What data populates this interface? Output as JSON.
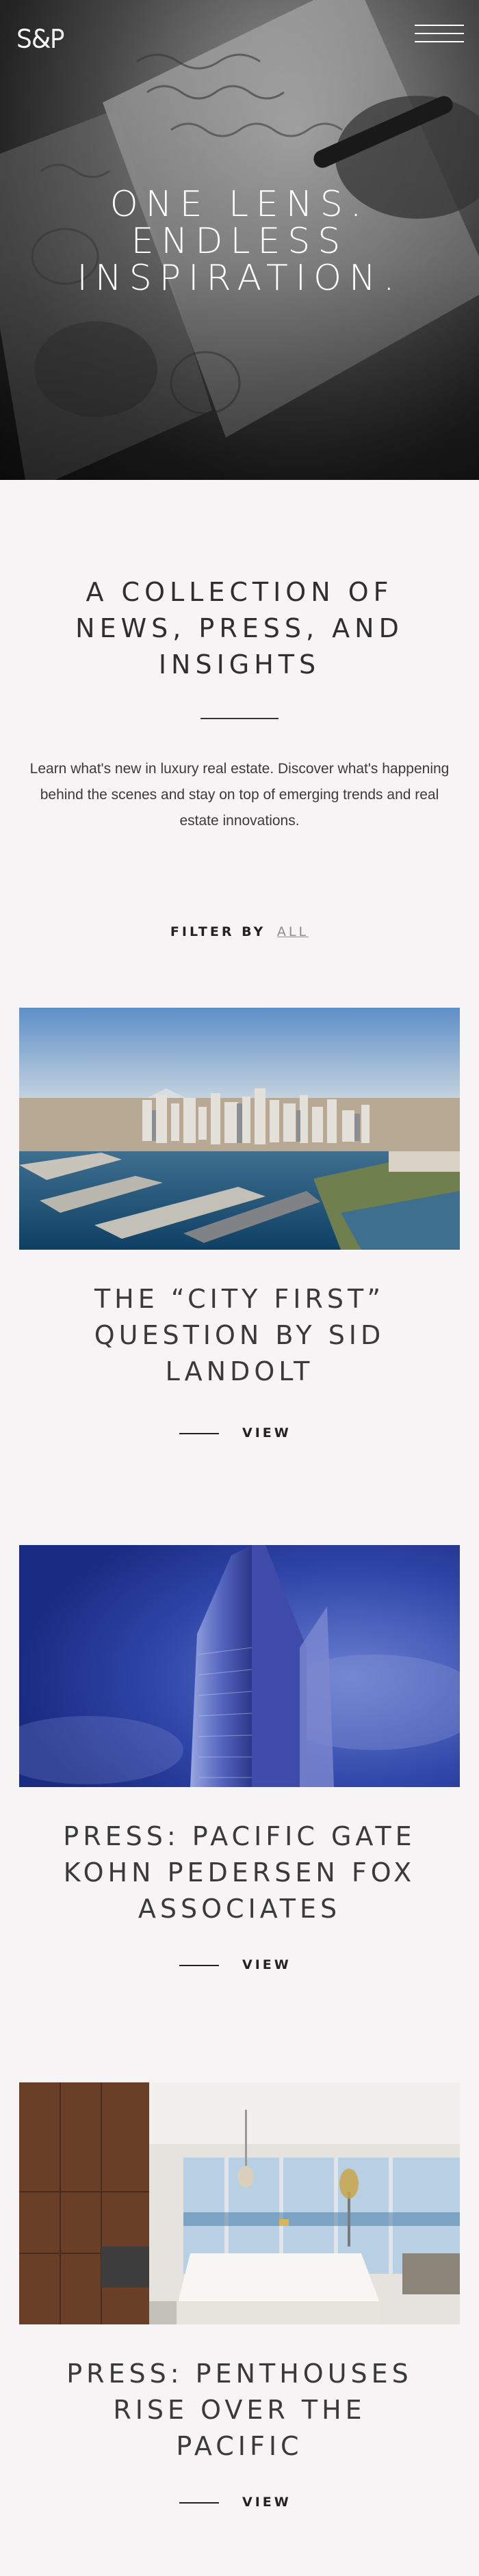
{
  "header": {
    "logo_text": "S&P",
    "menu_icon": "hamburger-menu-icon"
  },
  "hero": {
    "title_lines": [
      "ONE LENS.",
      "ENDLESS",
      "INSPIRATION."
    ],
    "image": "hand-writing-on-notebook-photo"
  },
  "intro": {
    "title_lines": [
      "A COLLECTION OF",
      "NEWS, PRESS, AND",
      "INSIGHTS"
    ],
    "text": "Learn what's new in luxury real estate. Discover what's happening behind the scenes and stay on top of emerging trends and real estate innovations."
  },
  "filter": {
    "label": "FILTER BY",
    "value": "ALL"
  },
  "posts": [
    {
      "title_lines": [
        "THE “CITY FIRST”",
        "QUESTION BY SID",
        "LANDOLT"
      ],
      "link_label": "VIEW",
      "image": "san-diego-waterfront-aerial-photo"
    },
    {
      "title_lines": [
        "PRESS: PACIFIC GATE",
        "KOHN PEDERSEN FOX",
        "ASSOCIATES"
      ],
      "link_label": "VIEW",
      "image": "glass-tower-against-blue-sky-photo"
    },
    {
      "title_lines": [
        "PRESS: PENTHOUSES",
        "RISE OVER THE",
        "PACIFIC"
      ],
      "link_label": "VIEW",
      "image": "penthouse-kitchen-interior-photo"
    }
  ]
}
